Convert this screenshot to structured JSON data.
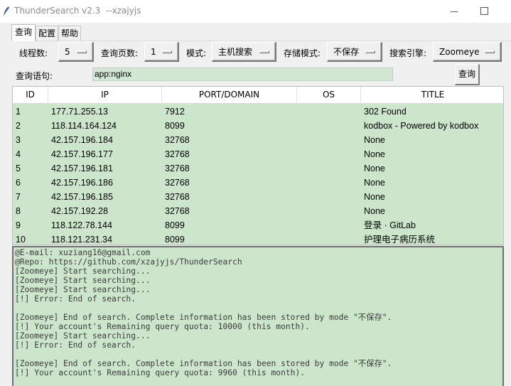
{
  "window": {
    "title": "ThunderSearch v2.3  --xzajyjs",
    "minimize_glyph": "—"
  },
  "tabs": [
    {
      "label": "查询"
    },
    {
      "label": "配置"
    },
    {
      "label": "帮助"
    }
  ],
  "toolbar": {
    "threads_label": "线程数:",
    "threads_value": "5",
    "pages_label": "查询页数:",
    "pages_value": "1",
    "mode_label": "模式:",
    "mode_value": "主机搜索",
    "storage_label": "存储模式:",
    "storage_value": "不保存",
    "engine_label": "搜索引擎:",
    "engine_value": "Zoomeye"
  },
  "query": {
    "label": "查询语句:",
    "value": "app:nginx",
    "button_label": "查询"
  },
  "table": {
    "columns": [
      "ID",
      "IP",
      "PORT/DOMAIN",
      "OS",
      "TITLE"
    ],
    "rows": [
      [
        "1",
        "177.71.255.13",
        "7912",
        "",
        "302 Found"
      ],
      [
        "2",
        "118.114.164.124",
        "8099",
        "",
        "kodbox - Powered by kodbox"
      ],
      [
        "3",
        "42.157.196.184",
        "32768",
        "",
        "None"
      ],
      [
        "4",
        "42.157.196.177",
        "32768",
        "",
        "None"
      ],
      [
        "5",
        "42.157.196.181",
        "32768",
        "",
        "None"
      ],
      [
        "6",
        "42.157.196.186",
        "32768",
        "",
        "None"
      ],
      [
        "7",
        "42.157.196.185",
        "32768",
        "",
        "None"
      ],
      [
        "8",
        "42.157.192.28",
        "32768",
        "",
        "None"
      ],
      [
        "9",
        "118.122.78.144",
        "8099",
        "",
        "登录 · GitLab"
      ],
      [
        "10",
        "118.121.231.34",
        "8099",
        "",
        "护理电子病历系统"
      ]
    ]
  },
  "log": {
    "lines": [
      "@E-mail: xuziang16@gmail.com",
      "@Repo: https://github.com/xzajyjs/ThunderSearch",
      "[Zoomeye] Start searching...",
      "[Zoomeye] Start searching...",
      "[Zoomeye] Start searching...",
      "[!] Error: End of search.",
      "",
      "[Zoomeye] End of search. Complete information has been stored by mode \"不保存\".",
      "[!] Your account's Remaining query quota: 10000 (this month).",
      "[Zoomeye] Start searching...",
      "[!] Error: End of search.",
      "",
      "[Zoomeye] End of search. Complete information has been stored by mode \"不保存\".",
      "[!] Your account's Remaining query quota: 9960 (this month)."
    ]
  },
  "colors": {
    "green_bg": "#cce6cc",
    "window_bg": "#f0f0f0"
  }
}
